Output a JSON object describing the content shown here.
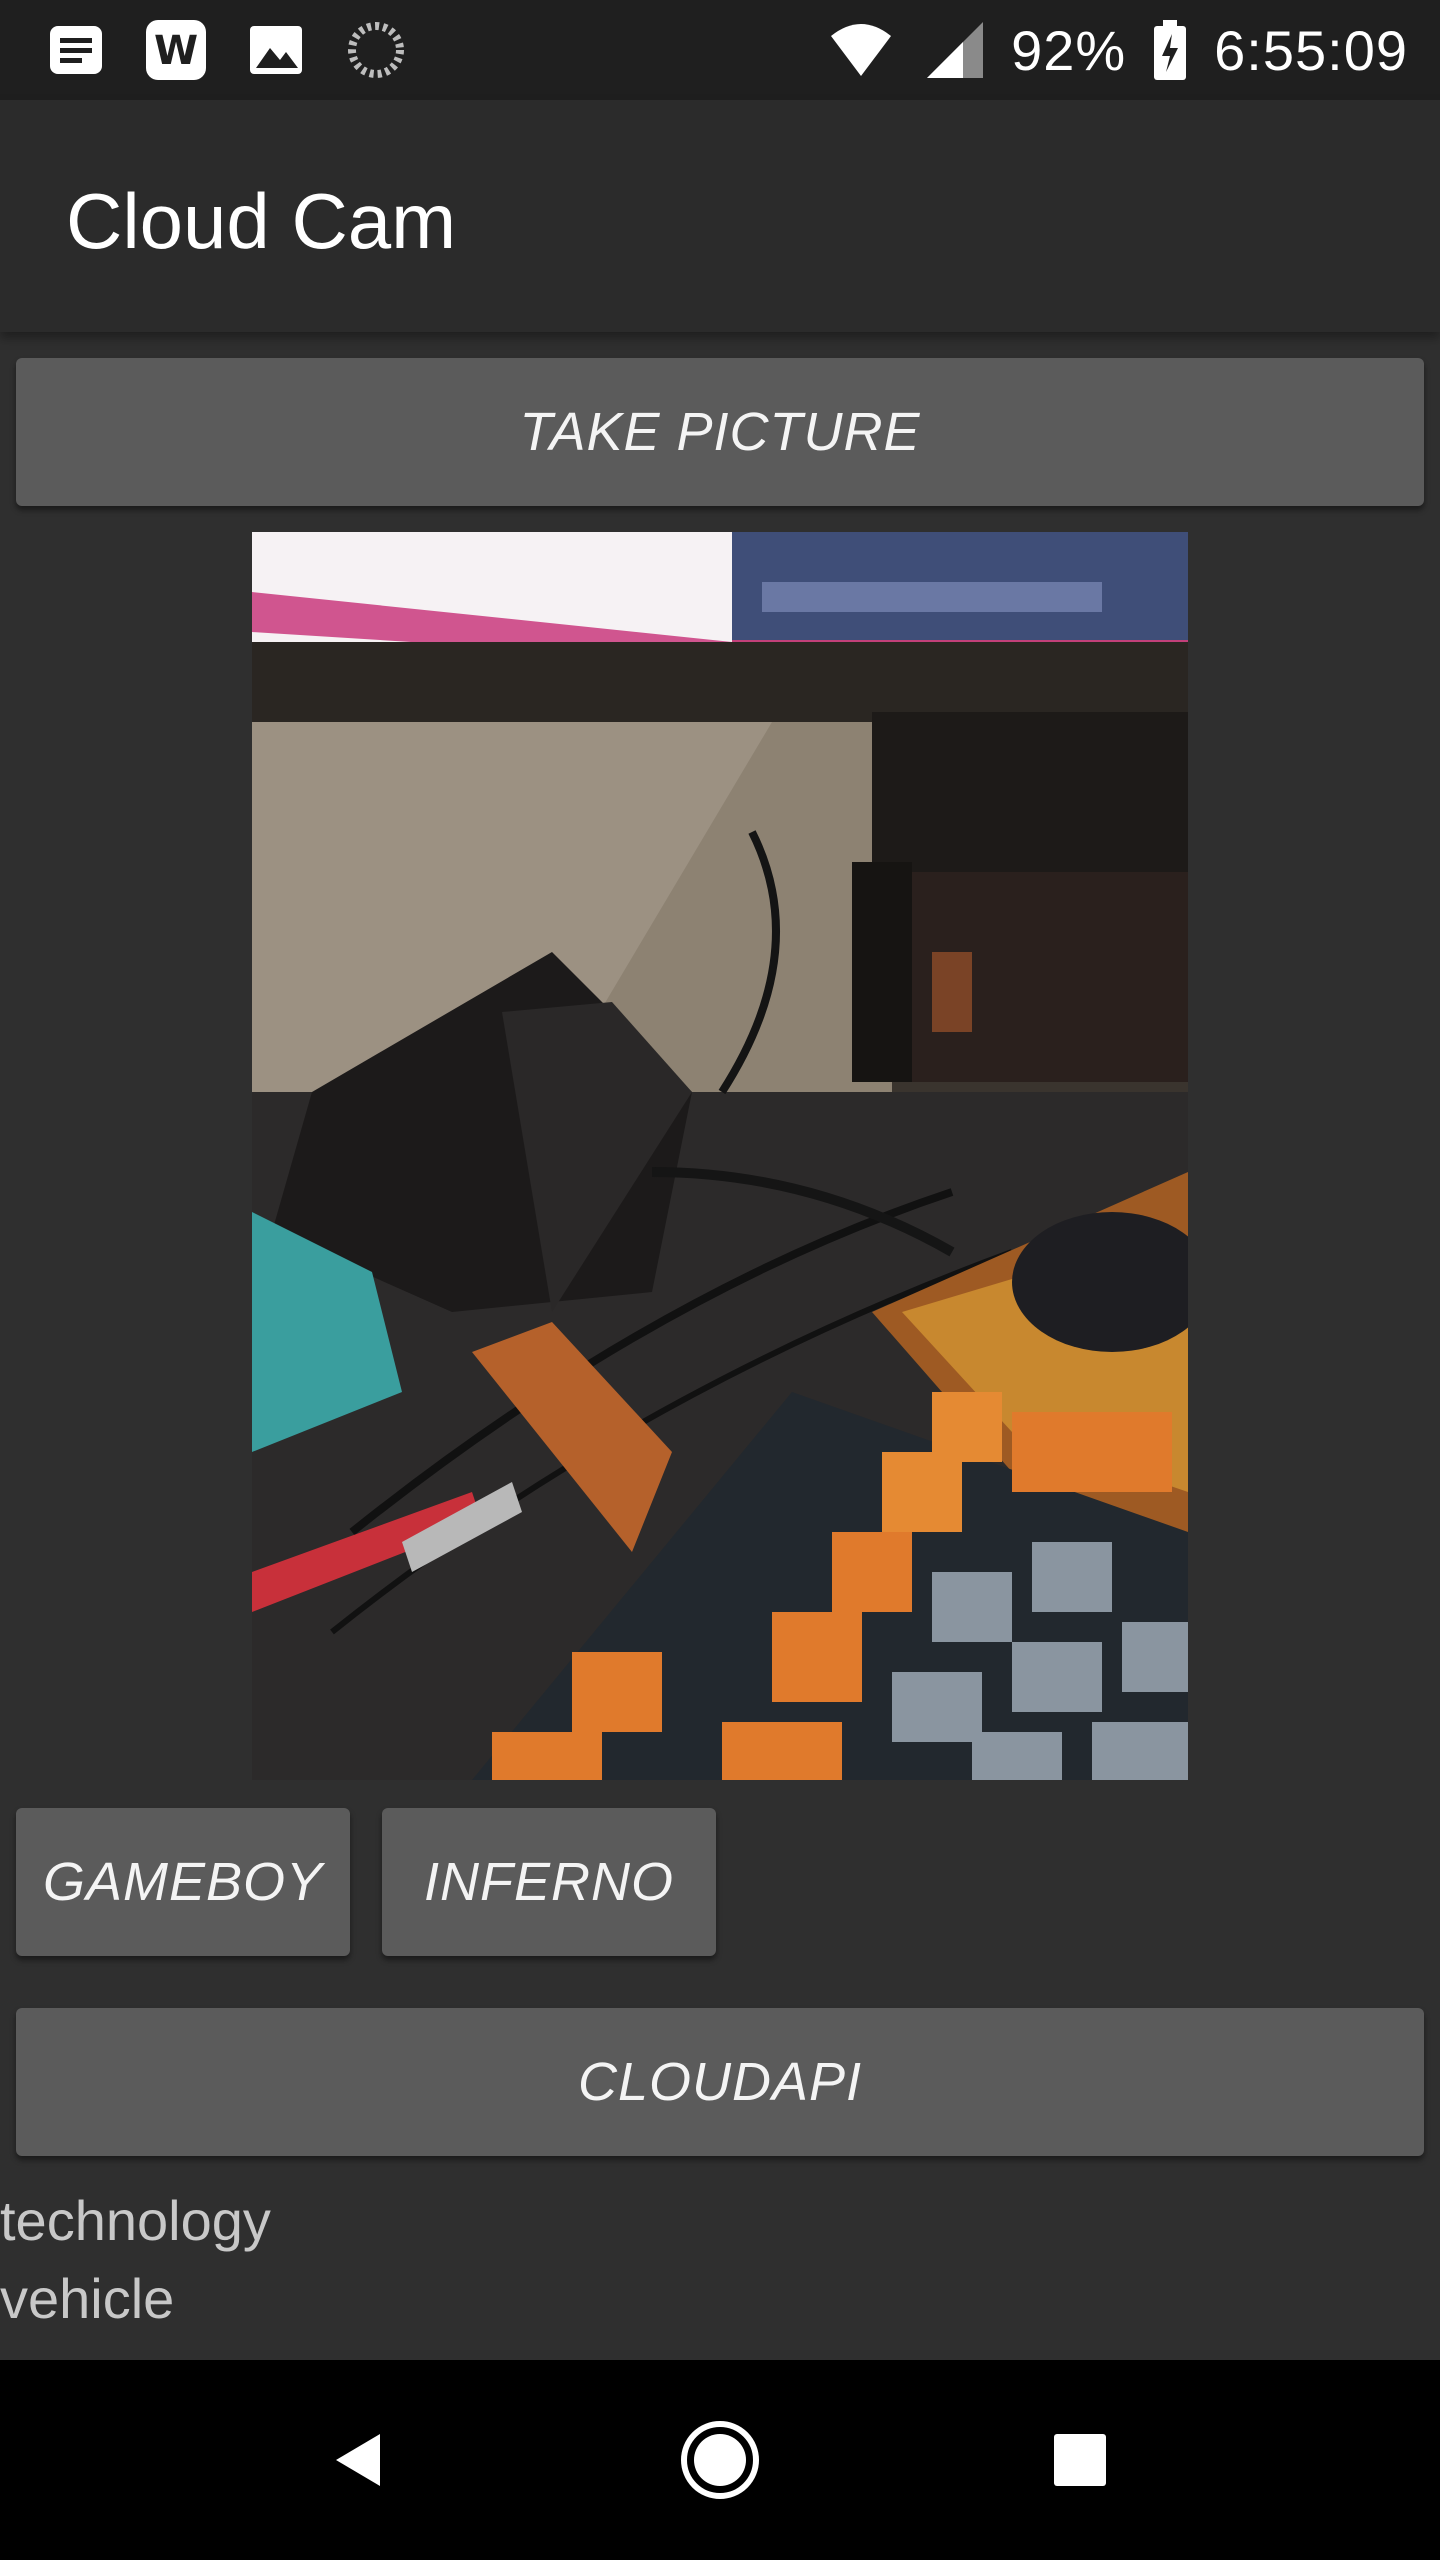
{
  "status_bar": {
    "battery": "92%",
    "time": "6:55:09",
    "icons": [
      "news-icon",
      "w-app-icon",
      "image-icon",
      "sync-spinner-icon",
      "wifi-icon",
      "signal-icon",
      "battery-charging-icon"
    ],
    "w_letter": "W"
  },
  "app": {
    "title": "Cloud Cam"
  },
  "buttons": {
    "take_picture": "TAKE PICTURE",
    "gameboy": "GAMEBOY",
    "inferno": "INFERNO",
    "cloudapi": "CLOUDAPI"
  },
  "photo": {
    "icon": "captured-photo-image"
  },
  "results": {
    "labels": [
      "technology",
      "vehicle"
    ]
  },
  "nav_bar": {
    "icons": [
      "back-icon",
      "home-icon",
      "recent-apps-icon"
    ]
  },
  "colors": {
    "background": "#2f2f2f",
    "app_bar": "#2b2b2b",
    "button": "#5b5b5b",
    "status_bar": "#1f1f1f",
    "nav_bar": "#000000"
  }
}
